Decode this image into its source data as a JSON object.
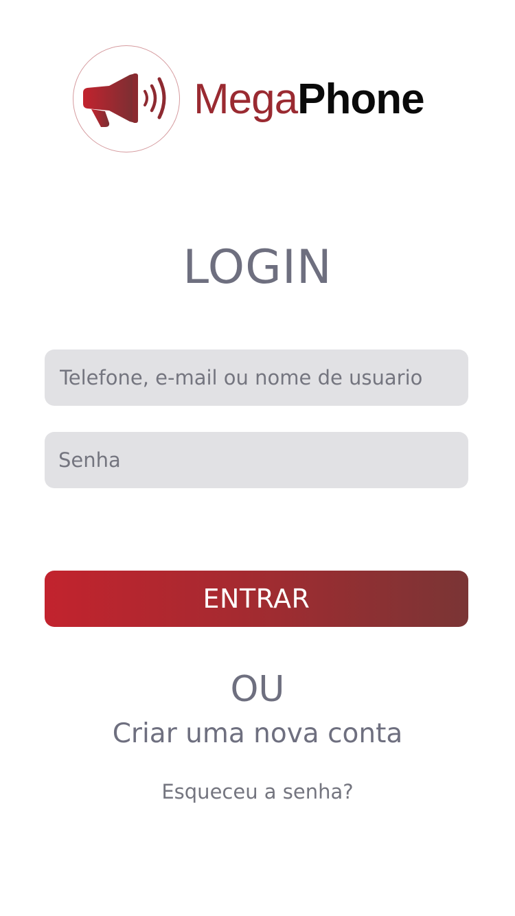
{
  "brand": {
    "name_part1": "Mega",
    "name_part2": "Phone",
    "logo_icon": "megaphone-icon",
    "colors": {
      "primary_red": "#c2232e",
      "dark_red": "#7a3535",
      "text_gray": "#6e6f7f",
      "field_bg": "#e1e1e4"
    }
  },
  "login": {
    "title": "LOGIN",
    "username_placeholder": "Telefone, e-mail ou nome de usuario",
    "password_placeholder": "Senha",
    "submit_label": "ENTRAR",
    "or_label": "OU",
    "create_account_label": "Criar uma nova conta",
    "forgot_password_label": "Esqueceu a senha?"
  }
}
